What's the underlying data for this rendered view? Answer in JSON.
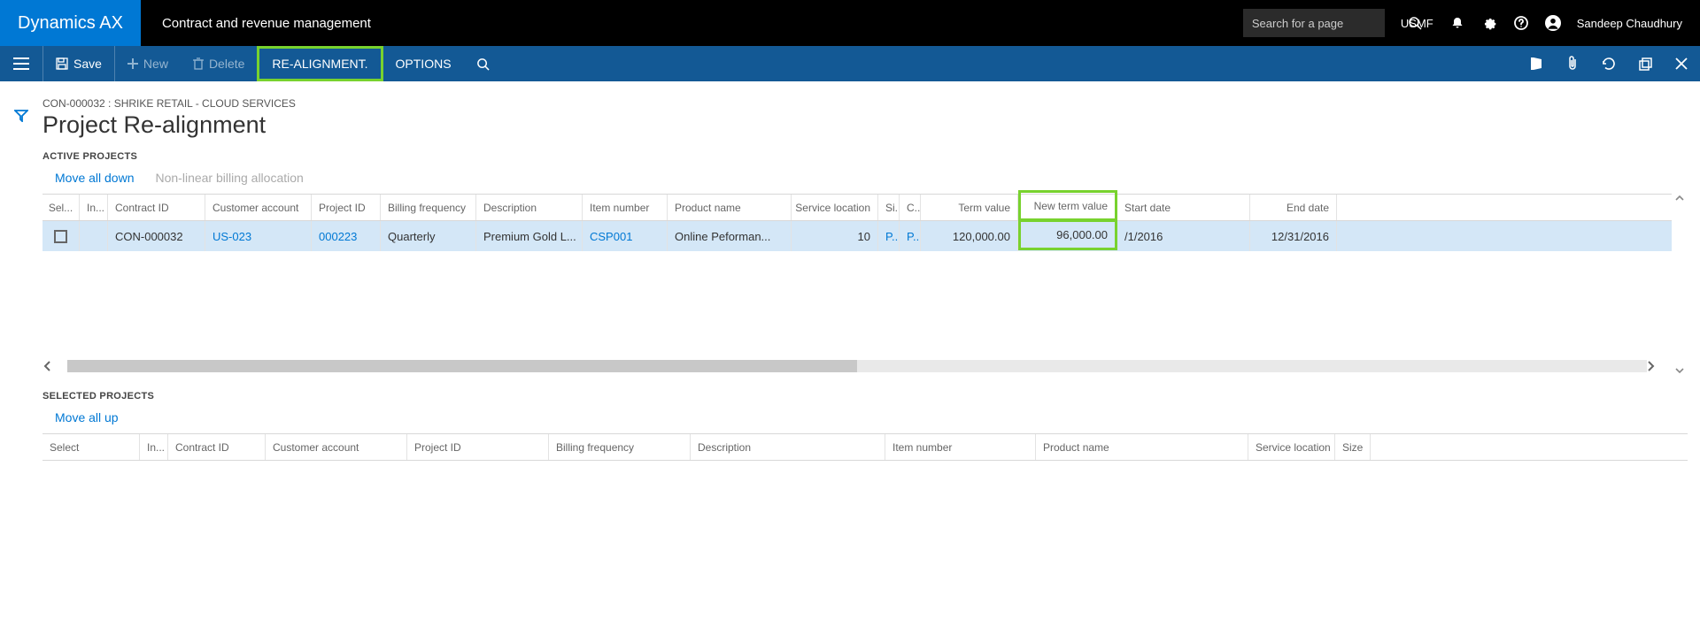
{
  "topbar": {
    "brand": "Dynamics AX",
    "breadcrumb": "Contract and revenue management",
    "search_placeholder": "Search for a page",
    "company": "USMF",
    "username": "Sandeep Chaudhury"
  },
  "cmdbar": {
    "save": "Save",
    "new": "New",
    "delete": "Delete",
    "realign": "RE-ALIGNMENT.",
    "options": "OPTIONS"
  },
  "page": {
    "context": "CON-000032 : SHRIKE RETAIL - CLOUD SERVICES",
    "title": "Project Re-alignment"
  },
  "active": {
    "section": "ACTIVE PROJECTS",
    "move_all_down": "Move all down",
    "nonlinear": "Non-linear billing allocation",
    "headers": {
      "sel": "Sel...",
      "in": "In...",
      "cid": "Contract ID",
      "cust": "Customer account",
      "pid": "Project ID",
      "bf": "Billing frequency",
      "desc": "Description",
      "item": "Item number",
      "pn": "Product name",
      "sl": "Service location",
      "si": "Si...",
      "cc": "C...",
      "tv": "Term value",
      "ntv": "New term value",
      "sd": "Start date",
      "ed": "End date"
    },
    "row": {
      "cid": "CON-000032",
      "cust": "US-023",
      "pid": "000223",
      "bf": "Quarterly",
      "desc": "Premium Gold L...",
      "item": "CSP001",
      "pn": "Online Peforman...",
      "sl": "10",
      "si": "P...",
      "cc": "P...",
      "tv": "120,000.00",
      "ntv": "96,000.00",
      "sd": "/1/2016",
      "ed": "12/31/2016"
    }
  },
  "selected": {
    "section": "SELECTED PROJECTS",
    "move_all_up": "Move all up",
    "headers": {
      "sel": "Select",
      "in": "In...",
      "cid": "Contract ID",
      "cust": "Customer account",
      "pid": "Project ID",
      "bf": "Billing frequency",
      "desc": "Description",
      "item": "Item number",
      "pn": "Product name",
      "sl": "Service location",
      "size": "Size"
    }
  }
}
